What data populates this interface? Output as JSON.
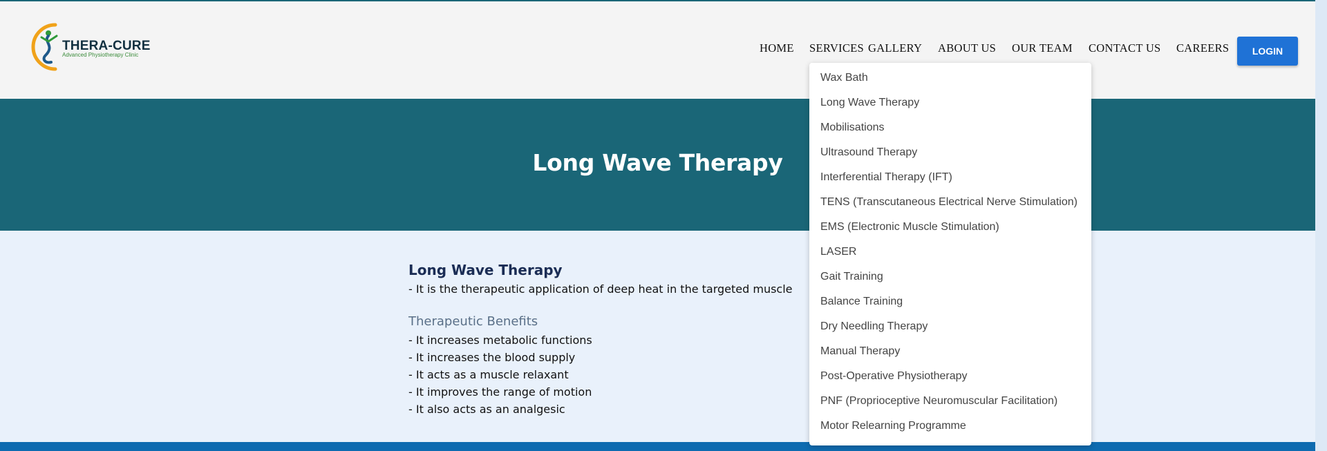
{
  "logo": {
    "name": "THERA-CURE",
    "tagline": "Advanced Physiotherapy Clinic"
  },
  "nav": {
    "items": [
      "HOME",
      "SERVICES",
      "GALLERY",
      "ABOUT US",
      "OUR TEAM",
      "CONTACT US",
      "CAREERS"
    ],
    "login_label": "LOGIN"
  },
  "services_menu": {
    "items": [
      "Wax Bath",
      "Long Wave Therapy",
      "Mobilisations",
      "Ultrasound Therapy",
      "Interferential Therapy (IFT)",
      "TENS (Transcutaneous Electrical Nerve Stimulation)",
      "EMS (Electronic Muscle Stimulation)",
      "LASER",
      "Gait Training",
      "Balance Training",
      "Dry Needling Therapy",
      "Manual Therapy",
      "Post-Operative Physiotherapy",
      "PNF (Proprioceptive Neuromuscular Facilitation)",
      "Motor Relearning Programme"
    ]
  },
  "hero": {
    "title": "Long Wave Therapy"
  },
  "content": {
    "heading": "Long Wave Therapy",
    "definition": "-  It is the therapeutic application of deep heat in the targeted muscle",
    "benefits_heading": "Therapeutic Benefits",
    "benefits": [
      "-  It increases metabolic functions",
      "-  It increases the blood supply",
      "-  It acts as a muscle relaxant",
      "-  It improves the range of motion",
      "-  It also acts as an analgesic"
    ]
  },
  "colors": {
    "hero_bg": "#1a6677",
    "login_bg": "#1f72d6",
    "page_bg": "#e9f1fb",
    "footer_bar": "#0e6bb0",
    "heading": "#1b2d55"
  }
}
